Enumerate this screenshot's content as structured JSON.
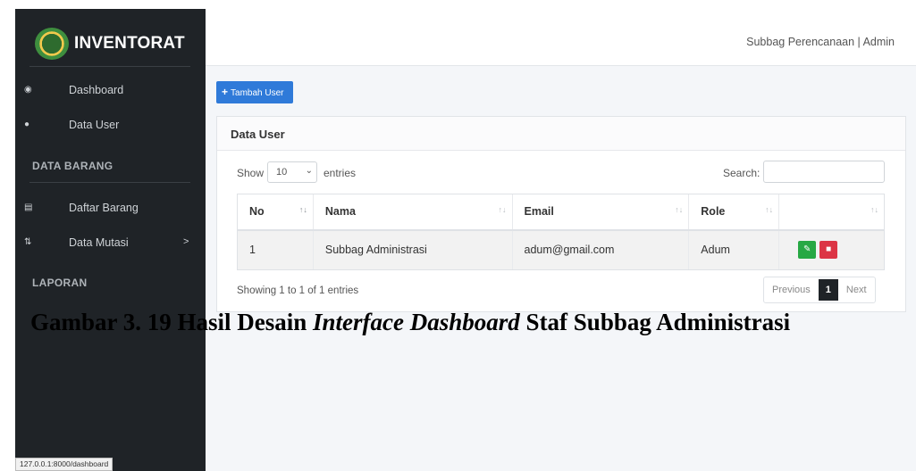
{
  "app": {
    "title": "INVENTORAT"
  },
  "topbar": {
    "user": "Subbag Perencanaan | Admin"
  },
  "sidebar": {
    "items": [
      {
        "label": "Dashboard",
        "icon": "dashboard-icon"
      },
      {
        "label": "Data User",
        "icon": "user-icon"
      }
    ],
    "section_barang": "DATA BARANG",
    "barang_items": [
      {
        "label": "Daftar Barang",
        "icon": "list-icon"
      },
      {
        "label": "Data Mutasi",
        "icon": "transfer-icon",
        "chevron": ">"
      }
    ],
    "section_laporan": "LAPORAN"
  },
  "status_url": "127.0.0.1:8000/dashboard",
  "main": {
    "add_button": "Tambah User",
    "card_title": "Data User",
    "show_label": "Show",
    "show_value": "10",
    "entries_label": "entries",
    "search_label": "Search:",
    "search_value": "",
    "table": {
      "headers": [
        "No",
        "Nama",
        "Email",
        "Role",
        ""
      ],
      "rows": [
        {
          "no": "1",
          "nama": "Subbag Administrasi",
          "email": "adum@gmail.com",
          "role": "Adum"
        }
      ]
    },
    "info": "Showing 1 to 1 of 1 entries",
    "pager": {
      "prev": "Previous",
      "current": "1",
      "next": "Next"
    }
  },
  "caption": {
    "part1": "Gambar 3. 19 Hasil Desain ",
    "part2_italic": "Interface Dashboard",
    "part3": " Staf Subbag Administrasi"
  }
}
